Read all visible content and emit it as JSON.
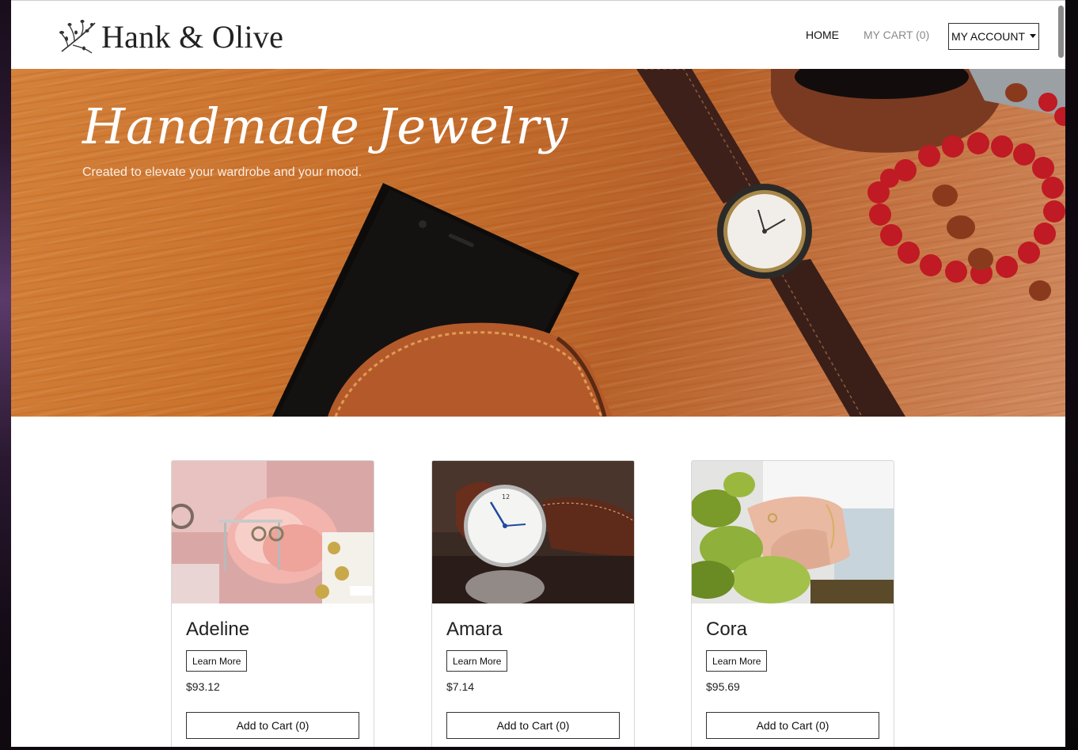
{
  "nav": {
    "brand": "Hank & Olive",
    "home": "HOME",
    "cart": "MY CART (0)",
    "account": "MY ACCOUNT"
  },
  "hero": {
    "title": "Handmade Jewelry",
    "subtitle": "Created to elevate your wardrobe and your mood."
  },
  "products": [
    {
      "name": "Adeline",
      "learn": "Learn More",
      "price": "$93.12",
      "cart": "Add to Cart (0)"
    },
    {
      "name": "Amara",
      "learn": "Learn More",
      "price": "$7.14",
      "cart": "Add to Cart (0)"
    },
    {
      "name": "Cora",
      "learn": "Learn More",
      "price": "$95.69",
      "cart": "Add to Cart (0)"
    }
  ],
  "colors": {
    "hero_wood": "#c9712c",
    "muted_nav": "#8a8a8a",
    "text": "#222222"
  }
}
